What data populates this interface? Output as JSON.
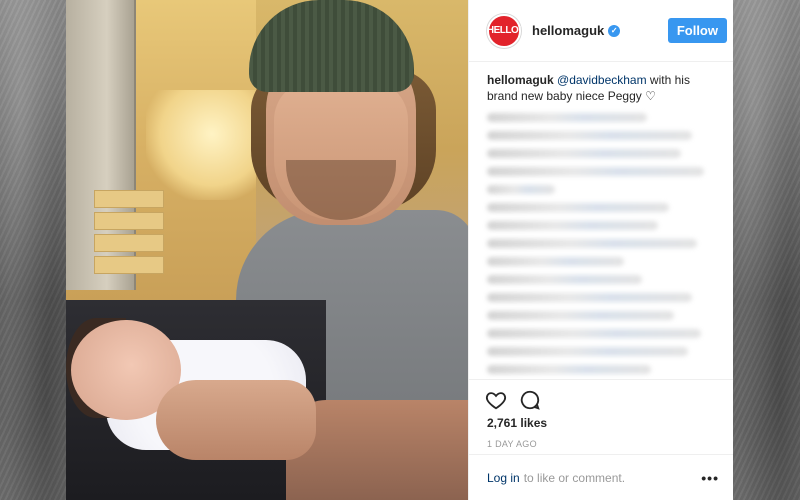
{
  "account": {
    "avatar_text": "HELLO!",
    "handle": "hellomaguk",
    "verified_icon": "verified-badge-icon",
    "follow_label": "Follow"
  },
  "caption": {
    "handle": "hellomaguk",
    "mention": "@davidbeckham",
    "text_line1": " with his",
    "text_line2": "brand new baby niece Peggy ",
    "emoji": "♡"
  },
  "post": {
    "likes": "2,761 likes",
    "time_ago": "1 DAY AGO"
  },
  "footer": {
    "login_label": "Log in",
    "prompt": "to like or comment.",
    "more_label": "•••"
  },
  "colors": {
    "accent": "#3897f0",
    "brand": "#e2232b",
    "link": "#003569"
  }
}
